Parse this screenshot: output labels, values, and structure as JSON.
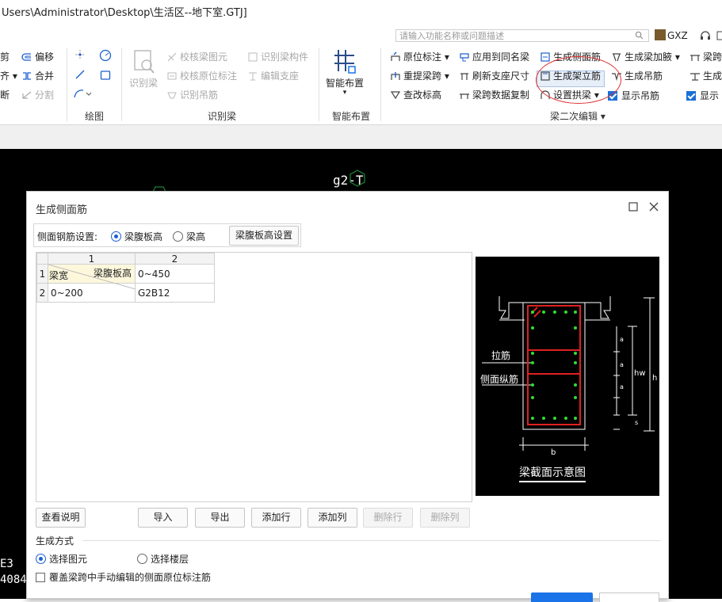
{
  "window": {
    "title": "Users\\Administrator\\Desktop\\生活区--地下室.GTJ]"
  },
  "search": {
    "placeholder": "请输入功能名称或问题描述"
  },
  "user": {
    "name": "GXZ"
  },
  "ribbon": {
    "draw_left": [
      {
        "label": "剪",
        "icon": "cut-icon"
      },
      {
        "label": "齐 ▾",
        "icon": "align-icon"
      },
      {
        "label": "断",
        "icon": "break-icon"
      }
    ],
    "draw_mid": [
      {
        "label": "偏移",
        "icon": "offset-icon"
      },
      {
        "label": "合并",
        "icon": "merge-icon"
      },
      {
        "label": "分割",
        "icon": "split-icon",
        "disabled": true
      }
    ],
    "draw_group_label": "绘图",
    "identify_beam": {
      "big_label": "识别梁",
      "items": [
        {
          "label": "校核梁图元",
          "icon": "check-beam-icon"
        },
        {
          "label": "校核原位标注",
          "icon": "check-annotation-icon"
        },
        {
          "label": "识别吊筋",
          "icon": "identify-hanger-icon"
        },
        {
          "label": "识别梁构件",
          "icon": "identify-component-icon"
        },
        {
          "label": "编辑支座",
          "icon": "edit-support-icon"
        }
      ],
      "group_label": "识别梁"
    },
    "smart_layout": {
      "big_label": "智能布置",
      "group_label": "智能布置"
    },
    "secondary_edit": {
      "group_label": "梁二次编辑 ▾",
      "col1": [
        {
          "label": "原位标注 ▾",
          "icon": "in-situ-annotation-icon"
        },
        {
          "label": "重提梁跨 ▾",
          "icon": "re-extract-span-icon"
        },
        {
          "label": "查改标高",
          "icon": "elevation-icon"
        }
      ],
      "col2": [
        {
          "label": "应用到同名梁",
          "icon": "apply-same-name-icon"
        },
        {
          "label": "刷新支座尺寸",
          "icon": "refresh-support-icon"
        },
        {
          "label": "梁跨数据复制",
          "icon": "copy-span-data-icon"
        }
      ],
      "col3": [
        {
          "label": "生成侧面筋",
          "icon": "side-rebar-icon"
        },
        {
          "label": "生成架立筋",
          "icon": "erection-rebar-icon"
        },
        {
          "label": "设置拱梁 ▾",
          "icon": "arch-beam-icon"
        }
      ],
      "col4": [
        {
          "label": "生成梁加腋 ▾",
          "icon": "haunch-icon"
        },
        {
          "label": "生成吊筋",
          "icon": "hanger-rebar-icon"
        },
        {
          "label": "显示吊筋",
          "checked": true
        }
      ],
      "col5": [
        {
          "label": "梁跨",
          "icon": "span-icon"
        },
        {
          "label": "生成",
          "icon": "generate-icon"
        },
        {
          "label": "显示",
          "checked": true
        }
      ]
    }
  },
  "canvas": {
    "label_top": "g2-T",
    "label_left1": "E3",
    "label_left2": "4084"
  },
  "dialog": {
    "title": "生成侧面筋",
    "setting_label": "侧面钢筋设置:",
    "radio1": "梁腹板高",
    "radio2": "梁高",
    "setting_button": "梁腹板高设置",
    "grid": {
      "col_headers": [
        "1",
        "2"
      ],
      "row_headers": [
        "1",
        "2"
      ],
      "corner_top": "梁腹板高",
      "corner_bottom": "梁宽",
      "rows": [
        [
          "0~450"
        ],
        [
          "0~200",
          "G2B12"
        ]
      ]
    },
    "preview": {
      "caption": "梁截面示意图",
      "label_tie": "拉筋",
      "label_side": "侧面纵筋",
      "dim_hw": "hw",
      "dim_h": "h",
      "dim_b": "b",
      "dim_a": "a",
      "dim_s": "s"
    },
    "buttons": {
      "help": "查看说明",
      "import": "导入",
      "export": "导出",
      "add_row": "添加行",
      "add_col": "添加列",
      "del_row": "删除行",
      "del_col": "删除列"
    },
    "gen_section": "生成方式",
    "gen_opt1": "选择图元",
    "gen_opt2": "选择楼层",
    "overwrite": "覆盖梁跨中手动编辑的侧面原位标注筋"
  }
}
